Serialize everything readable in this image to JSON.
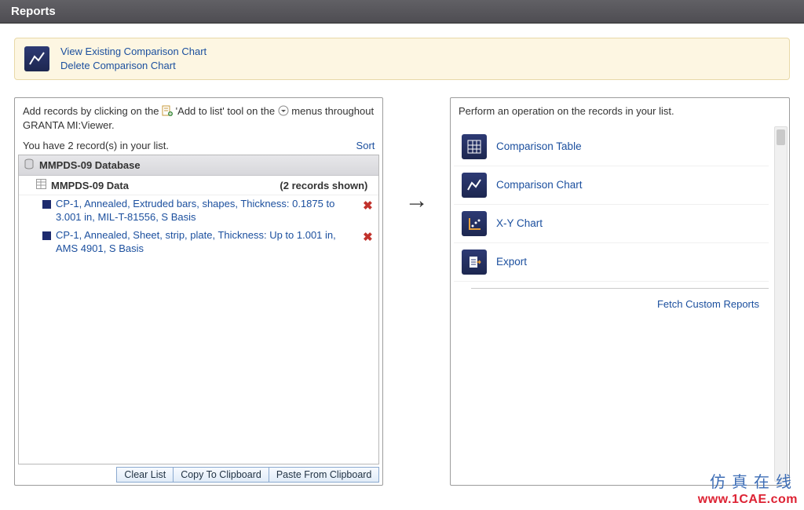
{
  "header": {
    "title": "Reports"
  },
  "banner": {
    "view_link": "View Existing Comparison Chart",
    "delete_link": "Delete Comparison Chart"
  },
  "left_panel": {
    "instr_prefix": "Add records by clicking on the ",
    "instr_mid": " 'Add to list' tool on the ",
    "instr_suffix": " menus throughout GRANTA MI:Viewer.",
    "count_text": "You have 2 record(s) in your list.",
    "sort_label": "Sort",
    "db_label": "MMPDS-09 Database",
    "data_label": "MMPDS-09 Data",
    "records_shown": "(2 records shown)",
    "records": [
      {
        "text": "CP-1, Annealed, Extruded bars, shapes, Thickness: 0.1875 to 3.001 in, MIL-T-81556, S Basis"
      },
      {
        "text": "CP-1, Annealed, Sheet, strip, plate, Thickness: Up to 1.001 in, AMS 4901, S Basis"
      }
    ],
    "buttons": {
      "clear": "Clear List",
      "copy": "Copy To Clipboard",
      "paste": "Paste From Clipboard"
    }
  },
  "right_panel": {
    "instr": "Perform an operation on the records in your list.",
    "ops": [
      {
        "label": "Comparison Table"
      },
      {
        "label": "Comparison Chart"
      },
      {
        "label": "X-Y Chart"
      },
      {
        "label": "Export"
      }
    ],
    "fetch": "Fetch Custom Reports"
  },
  "watermark": {
    "cn": "仿真在线",
    "url": "www.1CAE.com"
  }
}
